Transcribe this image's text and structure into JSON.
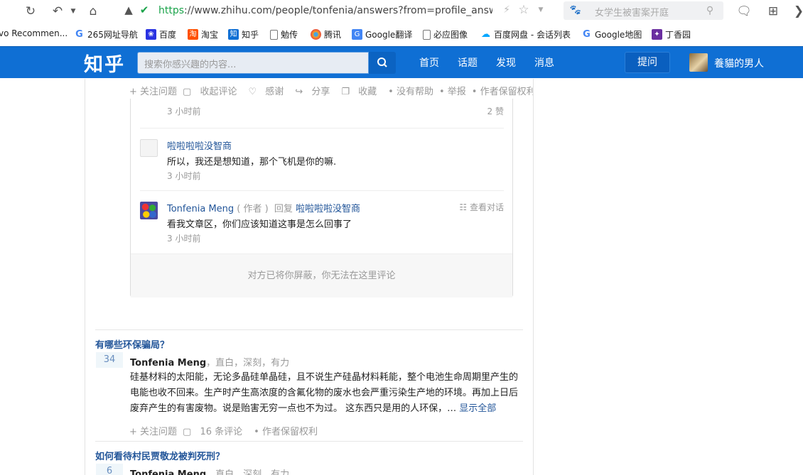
{
  "browser": {
    "url_scheme": "https",
    "url_rest": "://www.zhihu.com/people/tonfenia/answers?from=profile_answe",
    "search_placeholder": "女学生被害案开庭"
  },
  "bookmarks": [
    {
      "label": "vo Recommen...",
      "icon": "none",
      "color": "#ffffff"
    },
    {
      "label": "265网址导航",
      "icon": "google-g-icon",
      "color": "#4285f4"
    },
    {
      "label": "百度",
      "icon": "baidu-paw-icon",
      "color": "#2932e1"
    },
    {
      "label": "淘宝",
      "icon": "taobao-icon",
      "color": "#ff5000"
    },
    {
      "label": "知乎",
      "icon": "zhihu-icon",
      "color": "#0f6fd4"
    },
    {
      "label": "勉传",
      "icon": "page-icon",
      "color": "#ffffff"
    },
    {
      "label": "腾讯",
      "icon": "tencent-icon",
      "color": "#f5a623"
    },
    {
      "label": "Google翻译",
      "icon": "google-translate-icon",
      "color": "#4285f4"
    },
    {
      "label": "必应图像",
      "icon": "page-icon",
      "color": "#ffffff"
    },
    {
      "label": "百度网盘 - 会话列表",
      "icon": "baidu-pan-icon",
      "color": "#06a7ff"
    },
    {
      "label": "Google地图",
      "icon": "google-g-icon",
      "color": "#4285f4"
    },
    {
      "label": "丁香园",
      "icon": "dxy-icon",
      "color": "#6b2fa0"
    }
  ],
  "zhihu": {
    "logo": "知乎",
    "search_placeholder": "搜索你感兴趣的内容...",
    "nav": [
      "首页",
      "话题",
      "发现",
      "消息"
    ],
    "ask_label": "提问",
    "user_name": "養貓的男人"
  },
  "top_meta": [
    "+ 关注问题",
    "收起评论",
    "感谢",
    "分享",
    "收藏",
    "• 没有帮助",
    "• 举报",
    "• 作者保留权利"
  ],
  "comments": [
    {
      "time": "3 小时前",
      "likes": "2 赞"
    },
    {
      "name": "啦啦啦啦没智商",
      "text": "所以，我还是想知道，那个飞机是你的嘛.",
      "time": "3 小时前"
    },
    {
      "name": "Tonfenia Meng",
      "role": "( 作者 )",
      "reply": "回复",
      "reply_to": "啦啦啦啦没智商",
      "text": "看我文章区，你们应该知道这事是怎么回事了",
      "time": "3 小时前",
      "view_conv": "查看对话"
    }
  ],
  "blocked_text": "对方已将你屏蔽，你无法在这里评论",
  "answers": [
    {
      "title": "有哪些环保骗局？",
      "votes": "34",
      "author": "Tonfenia Meng",
      "tags": "，直白，深刻，有力",
      "excerpt": "硅基材料的太阳能，无论多晶硅单晶硅，且不说生产硅晶材料耗能，整个电池生命周期里产生的电能也收不回来。生产时产生高浓度的含氟化物的废水也会严重污染生产地的环境。再加上日后废弃产生的有害废物。说是贻害无穷一点也不为过。 这东西只是用的人环保，…",
      "show_all": "显示全部",
      "meta": [
        "+ 关注问题",
        "16 条评论",
        "• 作者保留权利"
      ]
    },
    {
      "title": "如何看待村民贾敬龙被判死刑？",
      "votes": "6",
      "author": "Tonfenia Meng",
      "tags": "，直白，深刻，有力"
    }
  ]
}
